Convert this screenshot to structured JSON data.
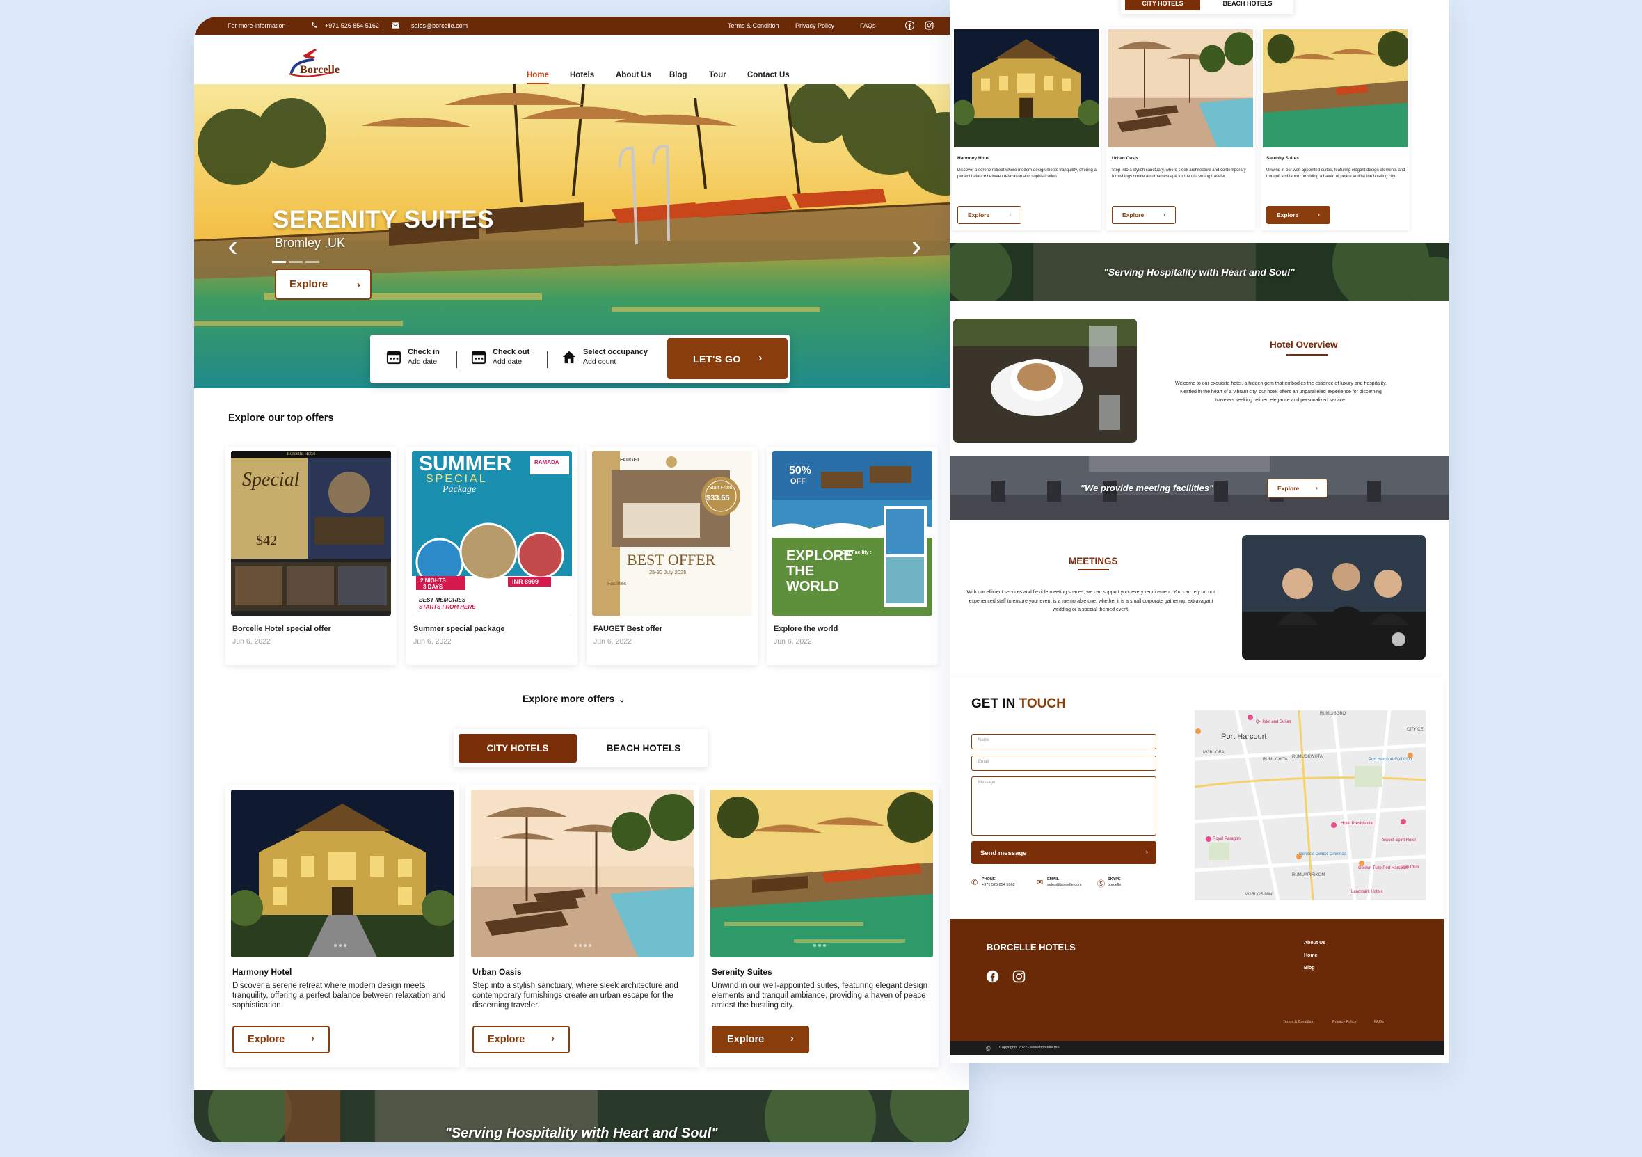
{
  "colors": {
    "brand_brown": "#7a2f09",
    "topbar_brown": "#6b2a07",
    "accent_orange": "#c2410c",
    "page_bg": "#dde9f8"
  },
  "topbar": {
    "info_label": "For more information",
    "phone": "+971 526 854 5162",
    "email": "sales@borcelle.com",
    "links": [
      "Terms & Condition",
      "Privacy Policy",
      "FAQs"
    ],
    "social_icons": [
      "facebook-icon",
      "instagram-icon"
    ]
  },
  "brand": {
    "name": "Borcelle"
  },
  "nav": {
    "items": [
      "Home",
      "Hotels",
      "About Us",
      "Blog",
      "Tour",
      "Contact Us"
    ],
    "active": "Home"
  },
  "hero": {
    "title": "SERENITY SUITES",
    "location": "Bromley ,UK",
    "button": "Explore",
    "slides": 3,
    "current_slide": 1
  },
  "booking": {
    "checkin_label": "Check in",
    "checkin_value": "Add date",
    "checkout_label": "Check out",
    "checkout_value": "Add date",
    "occupancy_label": "Select occupancy",
    "occupancy_value": "Add count",
    "submit": "LET'S GO"
  },
  "offers": {
    "heading": "Explore our top offers",
    "items": [
      {
        "title": "Borcelle Hotel special offer",
        "date": "Jun 6, 2022",
        "poster": {
          "brand": "Borcelle Hotel",
          "headline": "Special",
          "price": "$42"
        }
      },
      {
        "title": "Summer special package",
        "date": "Jun 6, 2022",
        "poster": {
          "headline": "SUMMER",
          "sub": "SPECIAL",
          "script": "Package",
          "brand": "RAMADA",
          "nights": "2 NIGHTS",
          "days": "3 DAYS",
          "price": "INR 8999",
          "tagline": "BEST MEMORIES",
          "tagline2": "STARTS FROM HERE"
        }
      },
      {
        "title": "FAUGET Best offer",
        "date": "Jun 6, 2022",
        "poster": {
          "brand": "FAUGET",
          "headline": "BEST OFFER",
          "dates": "25-30 July 2025",
          "badge_top": "Start From",
          "badge_price": "$33.65",
          "facilities": "Facilities"
        }
      },
      {
        "title": "Explore the world",
        "date": "Jun 6, 2022",
        "poster": {
          "discount": "50%",
          "discount_sub": "OFF",
          "headline": "EXPLORE",
          "headline2": "THE",
          "headline3": "WORLD",
          "facility_label": "Our Facility :"
        }
      }
    ],
    "more_label": "Explore more offers"
  },
  "hotel_tabs": {
    "items": [
      "CITY HOTELS",
      "BEACH HOTELS"
    ],
    "active": "CITY HOTELS"
  },
  "hotels": [
    {
      "name": "Harmony Hotel",
      "description": "Discover a serene retreat where modern design meets tranquility, offering a perfect balance between relaxation and sophistication.",
      "button": "Explore"
    },
    {
      "name": "Urban Oasis",
      "description": "Step into a stylish sanctuary, where sleek architecture and contemporary furnishings create an urban escape for the discerning traveler.",
      "button": "Explore"
    },
    {
      "name": "Serenity Suites",
      "description": "Unwind in our well-appointed suites, featuring elegant design elements and tranquil ambiance, providing a haven of peace amidst the bustling city.",
      "button": "Explore"
    }
  ],
  "quote": "\"Serving Hospitality with Heart and Soul\"",
  "overview": {
    "title": "Hotel Overview",
    "text": "Welcome to our exquisite hotel, a hidden gem that embodies the essence of luxury and hospitality. Nestled in the heart of a vibrant city, our hotel offers an unparalleled experience for discerning travelers seeking refined elegance and personalized service."
  },
  "meeting_band": {
    "quote": "\"We provide meeting facilities\"",
    "button": "Explore"
  },
  "meetings": {
    "title": "MEETINGS",
    "text": "With our efficient services and flexible meeting spaces, we can support your every requirement. You can rely on our experienced staff to ensure your event is a memorable one, whether it is a small corporate gathering, extravagant wedding or a special themed event."
  },
  "contact": {
    "title_part1": "GET IN",
    "title_part2": "TOUCH",
    "name_placeholder": "Name",
    "email_placeholder": "Email",
    "message_placeholder": "Message",
    "send": "Send message",
    "info": [
      {
        "label": "PHONE",
        "value": "+971 526 854 5162",
        "icon": "phone-icon"
      },
      {
        "label": "EMAIL",
        "value": "sales@borcelle.com",
        "icon": "mail-icon"
      },
      {
        "label": "SKYPE",
        "value": "borcelle",
        "icon": "skype-icon"
      }
    ],
    "map_labels": [
      "RUMUIBGBO",
      "Q-Hotel and Suites",
      "Port Harcourt",
      "CITY CE",
      "MGBUOBA",
      "RUMUCHITA",
      "RUMUOKWUTA",
      "Port Harcourt Golf Club",
      "Royal Paragon",
      "Hotel Presidential",
      "RUMUAPIRIKOM",
      "Genesis Deluxe Cinemas",
      "Golden Tulip Port Harcourt",
      "Landmark Hotels",
      "MGBUOSIMINI",
      "Sweet Spirit Hotel",
      "Polo Club"
    ]
  },
  "footer": {
    "brand": "BORCELLE HOTELS",
    "links": [
      "About Us",
      "Home",
      "Blog"
    ],
    "bottom_links": [
      "Terms & Condition",
      "Privacy Policy",
      "FAQs"
    ],
    "copyright": "Copyrights 2022 - www.borcelle.me"
  }
}
